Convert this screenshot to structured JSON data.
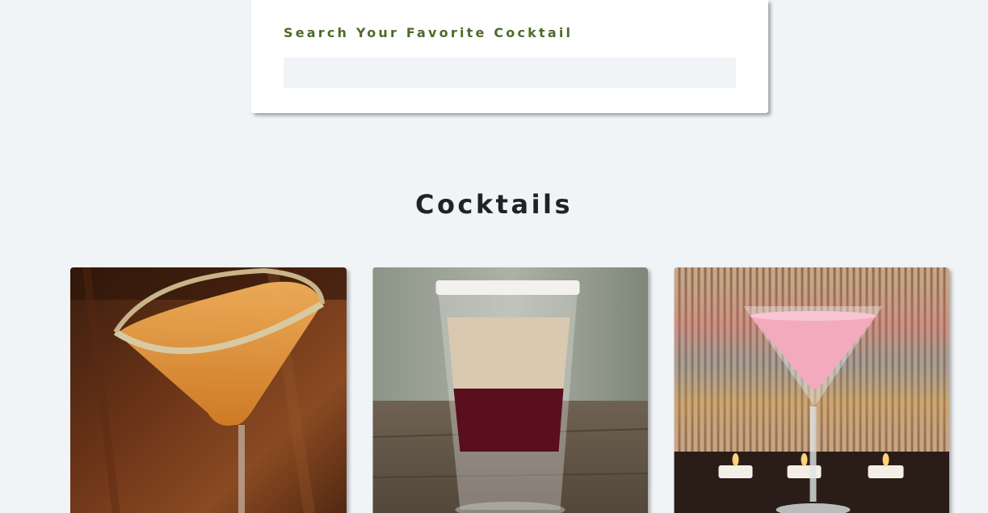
{
  "search": {
    "label": "Search Your Favorite Cocktail",
    "value": "",
    "placeholder": ""
  },
  "section": {
    "title": "Cocktails"
  },
  "colors": {
    "background": "#f1f4f7",
    "label_green": "#4c6b2b",
    "title": "#222222"
  },
  "cocktails": [
    {
      "drink": "orange-martini",
      "liquid_color": "#e39a3a"
    },
    {
      "drink": "layered-shot",
      "liquid_color": "#d8c9b0"
    },
    {
      "drink": "pink-martini",
      "liquid_color": "#f4aabd"
    }
  ]
}
